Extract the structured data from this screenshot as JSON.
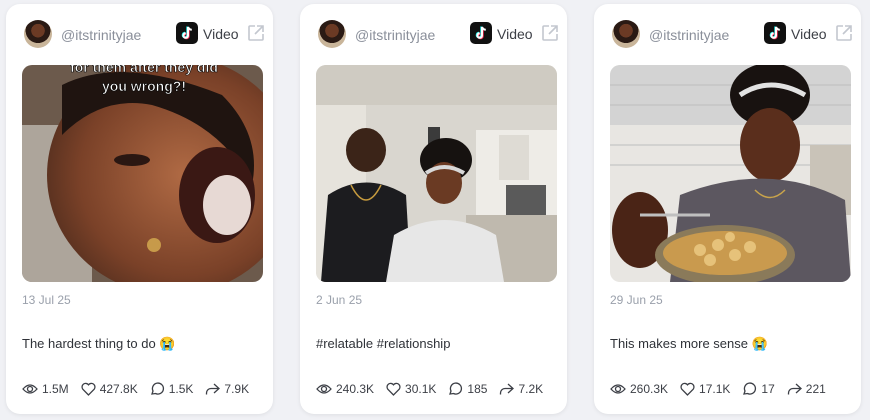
{
  "cards": [
    {
      "handle": "@itstrinityjae",
      "platform_icon": "tiktok-icon",
      "type_label": "Video",
      "thumbnail_overlay": "for them after they did\nyou wrong?!",
      "date": "13 Jul 25",
      "caption": "The hardest thing to do 😭",
      "views": "1.5M",
      "likes": "427.8K",
      "comments": "1.5K",
      "shares": "7.9K"
    },
    {
      "handle": "@itstrinityjae",
      "platform_icon": "tiktok-icon",
      "type_label": "Video",
      "thumbnail_overlay": "",
      "date": "2 Jun 25",
      "caption": "#relatable #relationship",
      "views": "240.3K",
      "likes": "30.1K",
      "comments": "185",
      "shares": "7.2K"
    },
    {
      "handle": "@itstrinityjae",
      "platform_icon": "tiktok-icon",
      "type_label": "Video",
      "thumbnail_overlay": "",
      "date": "29 Jun 25",
      "caption": "This makes more sense 😭",
      "views": "260.3K",
      "likes": "17.1K",
      "comments": "17",
      "shares": "221"
    }
  ]
}
